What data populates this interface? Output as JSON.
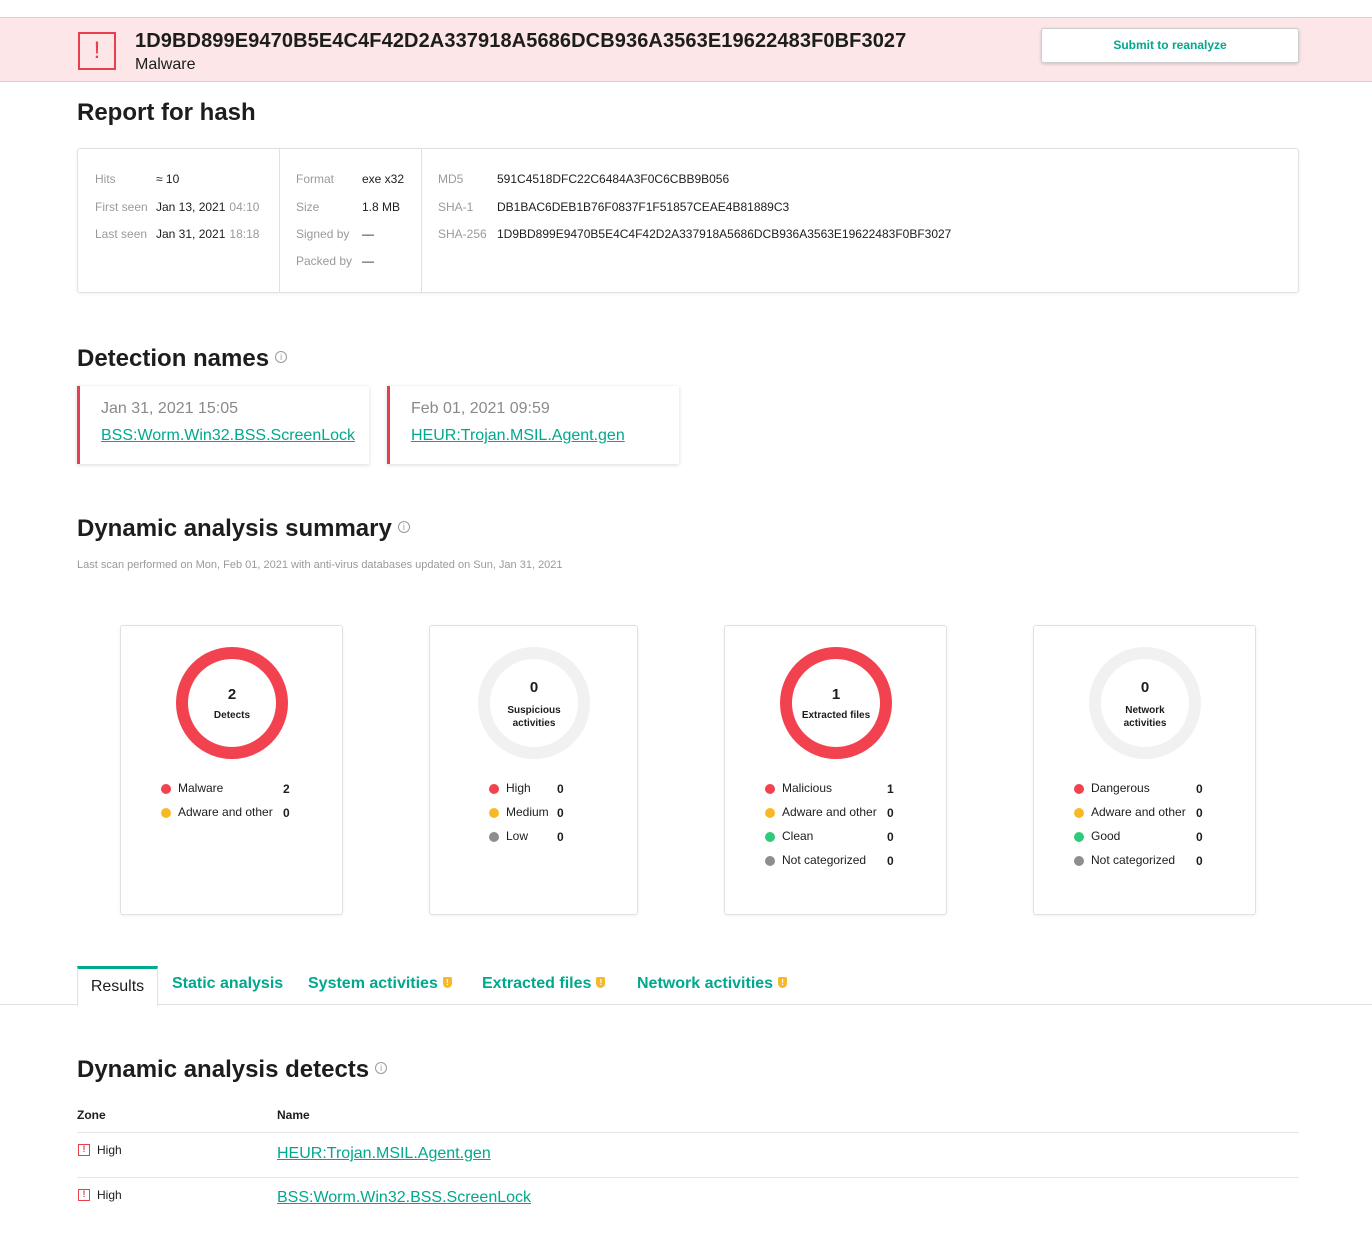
{
  "banner": {
    "hash": "1D9BD899E9470B5E4C4F42D2A337918A5686DCB936A3563E19622483F0BF3027",
    "verdict": "Malware",
    "reanalyze_label": "Submit to reanalyze",
    "alert_symbol": "!"
  },
  "report": {
    "title": "Report for hash",
    "hits_label": "Hits",
    "hits_value": "≈ 10",
    "first_seen_label": "First seen",
    "first_seen_date": "Jan 13, 2021",
    "first_seen_time": "04:10",
    "last_seen_label": "Last seen",
    "last_seen_date": "Jan 31, 2021",
    "last_seen_time": "18:18",
    "format_label": "Format",
    "format_value": "exe x32",
    "size_label": "Size",
    "size_value": "1.8 MB",
    "signed_label": "Signed by",
    "signed_value": "—",
    "packed_label": "Packed by",
    "packed_value": "—",
    "md5_label": "MD5",
    "md5_value": "591C4518DFC22C6484A3F0C6CBB9B056",
    "sha1_label": "SHA-1",
    "sha1_value": "DB1BAC6DEB1B76F0837F1F51857CEAE4B81889C3",
    "sha256_label": "SHA-256",
    "sha256_value": "1D9BD899E9470B5E4C4F42D2A337918A5686DCB936A3563E19622483F0BF3027"
  },
  "detection": {
    "title": "Detection names",
    "cards": [
      {
        "date": "Jan 31, 2021 15:05",
        "name": "BSS:Worm.Win32.BSS.ScreenLock"
      },
      {
        "date": "Feb 01, 2021  09:59",
        "name": "HEUR:Trojan.MSIL.Agent.gen"
      }
    ]
  },
  "summary": {
    "title": "Dynamic analysis summary",
    "subtitle": "Last scan performed on Mon, Feb 01, 2021 with anti-virus databases updated on Sun, Jan 31, 2021",
    "cards": [
      {
        "value": "2",
        "label": "Detects",
        "legend": [
          {
            "label": "Malware",
            "value": "2",
            "color": "red"
          },
          {
            "label": "Adware and other",
            "value": "0",
            "color": "amber"
          }
        ]
      },
      {
        "value": "0",
        "label": "Suspicious activities",
        "legend": [
          {
            "label": "High",
            "value": "0",
            "color": "red"
          },
          {
            "label": "Medium",
            "value": "0",
            "color": "amber"
          },
          {
            "label": "Low",
            "value": "0",
            "color": "grey"
          }
        ]
      },
      {
        "value": "1",
        "label": "Extracted files",
        "legend": [
          {
            "label": "Malicious",
            "value": "1",
            "color": "red"
          },
          {
            "label": "Adware and other",
            "value": "0",
            "color": "amber"
          },
          {
            "label": "Clean",
            "value": "0",
            "color": "green"
          },
          {
            "label": "Not categorized",
            "value": "0",
            "color": "grey"
          }
        ]
      },
      {
        "value": "0",
        "label": "Network activities",
        "legend": [
          {
            "label": "Dangerous",
            "value": "0",
            "color": "red"
          },
          {
            "label": "Adware and other",
            "value": "0",
            "color": "amber"
          },
          {
            "label": "Good",
            "value": "0",
            "color": "green"
          },
          {
            "label": "Not categorized",
            "value": "0",
            "color": "grey"
          }
        ]
      }
    ]
  },
  "colors": {
    "accent": "#00a88e",
    "danger": "#f2424f",
    "warning": "#f7b928",
    "good": "#2fcb7b",
    "neutral": "#8e8e8e",
    "banner_bg": "#fce6e8"
  },
  "tabs": [
    {
      "label": "Results",
      "active": true
    },
    {
      "label": "Static analysis"
    },
    {
      "label": "System activities",
      "badge": true
    },
    {
      "label": "Extracted files",
      "badge": true
    },
    {
      "label": "Network activities",
      "badge": true
    }
  ],
  "detects": {
    "title": "Dynamic analysis detects",
    "col_zone": "Zone",
    "col_name": "Name",
    "rows": [
      {
        "zone": "High",
        "name": "HEUR:Trojan.MSIL.Agent.gen"
      },
      {
        "zone": "High",
        "name": "BSS:Worm.Win32.BSS.ScreenLock"
      }
    ]
  }
}
